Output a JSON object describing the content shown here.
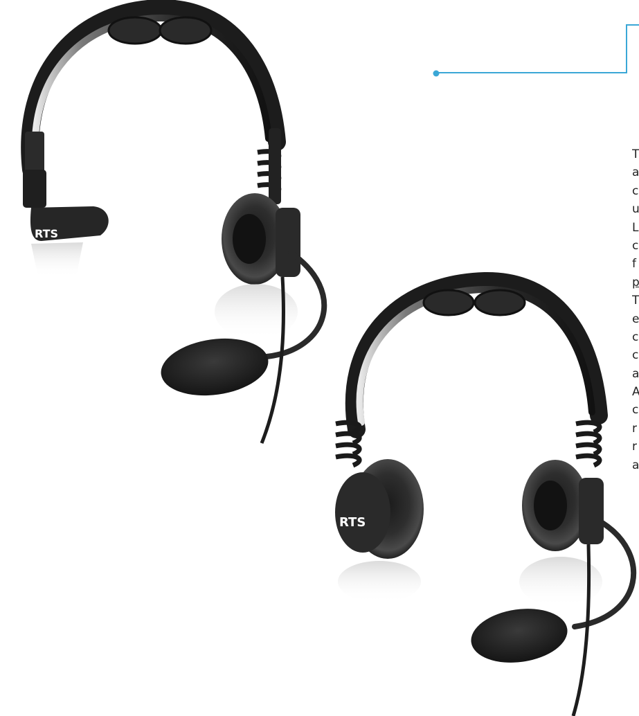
{
  "page": {
    "accent_color": "#3aa7d6",
    "logo_left": "RTS",
    "logo_right": "RTS"
  },
  "text_column": {
    "lines": [
      "T",
      "a",
      "c",
      "u",
      "L",
      "c",
      "f",
      "p",
      "T",
      "e",
      "c",
      "c",
      "a",
      "A",
      "c",
      "r",
      "r",
      "a"
    ],
    "underlined_index": 7
  }
}
